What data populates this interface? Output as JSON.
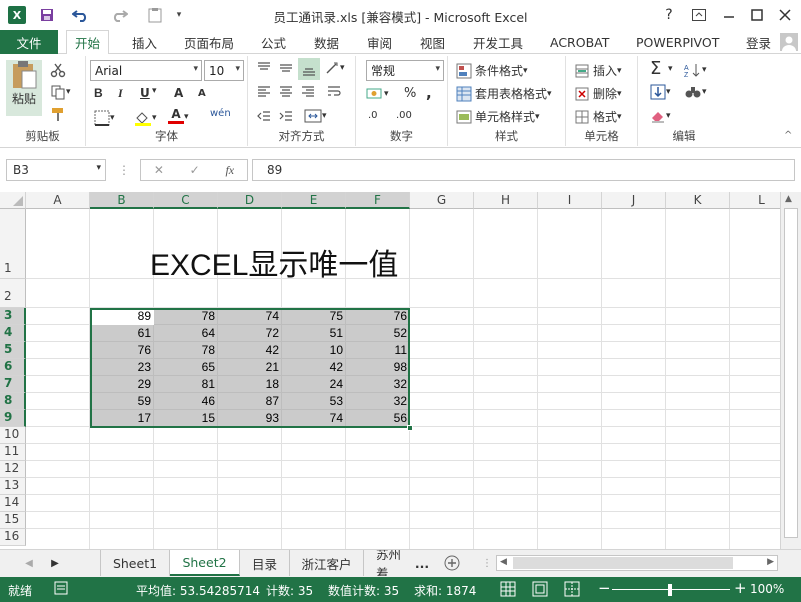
{
  "window": {
    "title": "员工通讯录.xls  [兼容模式] - Microsoft Excel",
    "help": "?",
    "accent": "#217346"
  },
  "tabs": {
    "file": "文件",
    "items": [
      "开始",
      "插入",
      "页面布局",
      "公式",
      "数据",
      "审阅",
      "视图",
      "开发工具",
      "ACROBAT",
      "POWERPIVOT"
    ],
    "active": "开始",
    "login": "登录"
  },
  "ribbon": {
    "clipboard": {
      "paste": "粘贴",
      "label": "剪贴板"
    },
    "font": {
      "name": "Arial",
      "size": "10",
      "label": "字体",
      "bold": "B",
      "italic": "I",
      "underline": "U",
      "grow": "A",
      "shrink": "A",
      "color": "A",
      "wen": "wén"
    },
    "alignment": {
      "label": "对齐方式"
    },
    "number": {
      "format": "常规",
      "percent": "%",
      "comma": ",",
      "inc": ".0",
      "dec": ".00",
      "label": "数字"
    },
    "styles": {
      "conditional": "条件格式",
      "table": "套用表格格式",
      "cell": "单元格样式",
      "label": "样式"
    },
    "cells": {
      "insert": "插入",
      "delete": "删除",
      "format": "格式",
      "label": "单元格"
    },
    "editing": {
      "sigma": "Σ",
      "label": "编辑"
    }
  },
  "formula_bar": {
    "name_box": "B3",
    "fx": "fx",
    "value": "89"
  },
  "sheet": {
    "columns": [
      "A",
      "B",
      "C",
      "D",
      "E",
      "F",
      "G",
      "H",
      "I",
      "J",
      "K",
      "L"
    ],
    "rows": [
      "1",
      "2",
      "3",
      "4",
      "5",
      "6",
      "7",
      "8",
      "9",
      "10",
      "11",
      "12",
      "13",
      "14",
      "15",
      "16"
    ],
    "title": "EXCEL显示唯一值",
    "data": [
      [
        "89",
        "78",
        "74",
        "75",
        "76"
      ],
      [
        "61",
        "64",
        "72",
        "51",
        "52"
      ],
      [
        "76",
        "78",
        "42",
        "10",
        "11"
      ],
      [
        "23",
        "65",
        "21",
        "42",
        "98"
      ],
      [
        "29",
        "81",
        "18",
        "24",
        "32"
      ],
      [
        "59",
        "46",
        "87",
        "53",
        "32"
      ],
      [
        "17",
        "15",
        "93",
        "74",
        "56"
      ]
    ]
  },
  "sheet_tabs": {
    "items": [
      "Sheet1",
      "Sheet2",
      "目录",
      "浙江客户",
      "苏州着"
    ],
    "active": "Sheet2",
    "more": "..."
  },
  "status": {
    "mode": "就绪",
    "average": "平均值: 53.54285714",
    "count": "计数: 35",
    "numcount": "数值计数: 35",
    "sum": "求和: 1874",
    "zoom": "100%"
  }
}
